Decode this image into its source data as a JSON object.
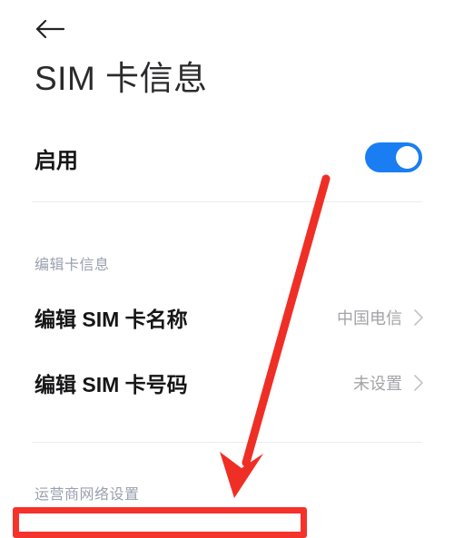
{
  "header": {
    "back_icon": "arrow-left-icon",
    "title": "SIM 卡信息"
  },
  "enable_row": {
    "label": "启用",
    "toggle_state": "on",
    "toggle_color": "#1a7df2"
  },
  "sections": [
    {
      "heading": "编辑卡信息",
      "rows": [
        {
          "label": "编辑 SIM 卡名称",
          "value": "中国电信",
          "chevron": "chevron-right-icon"
        },
        {
          "label": "编辑 SIM 卡号码",
          "value": "未设置",
          "chevron": "chevron-right-icon"
        }
      ]
    },
    {
      "heading": "运营商网络设置",
      "rows": []
    }
  ],
  "annotations": {
    "arrow_color": "#ef2f26",
    "highlight_color": "#f5322b",
    "arrow_name": "red-annotation-arrow",
    "rect_name": "red-annotation-highlight-box"
  },
  "colors": {
    "text_primary": "#161618",
    "text_secondary": "#a4a4a8",
    "section_label": "#9aa0ae",
    "divider": "#ededef",
    "background": "#ffffff"
  }
}
